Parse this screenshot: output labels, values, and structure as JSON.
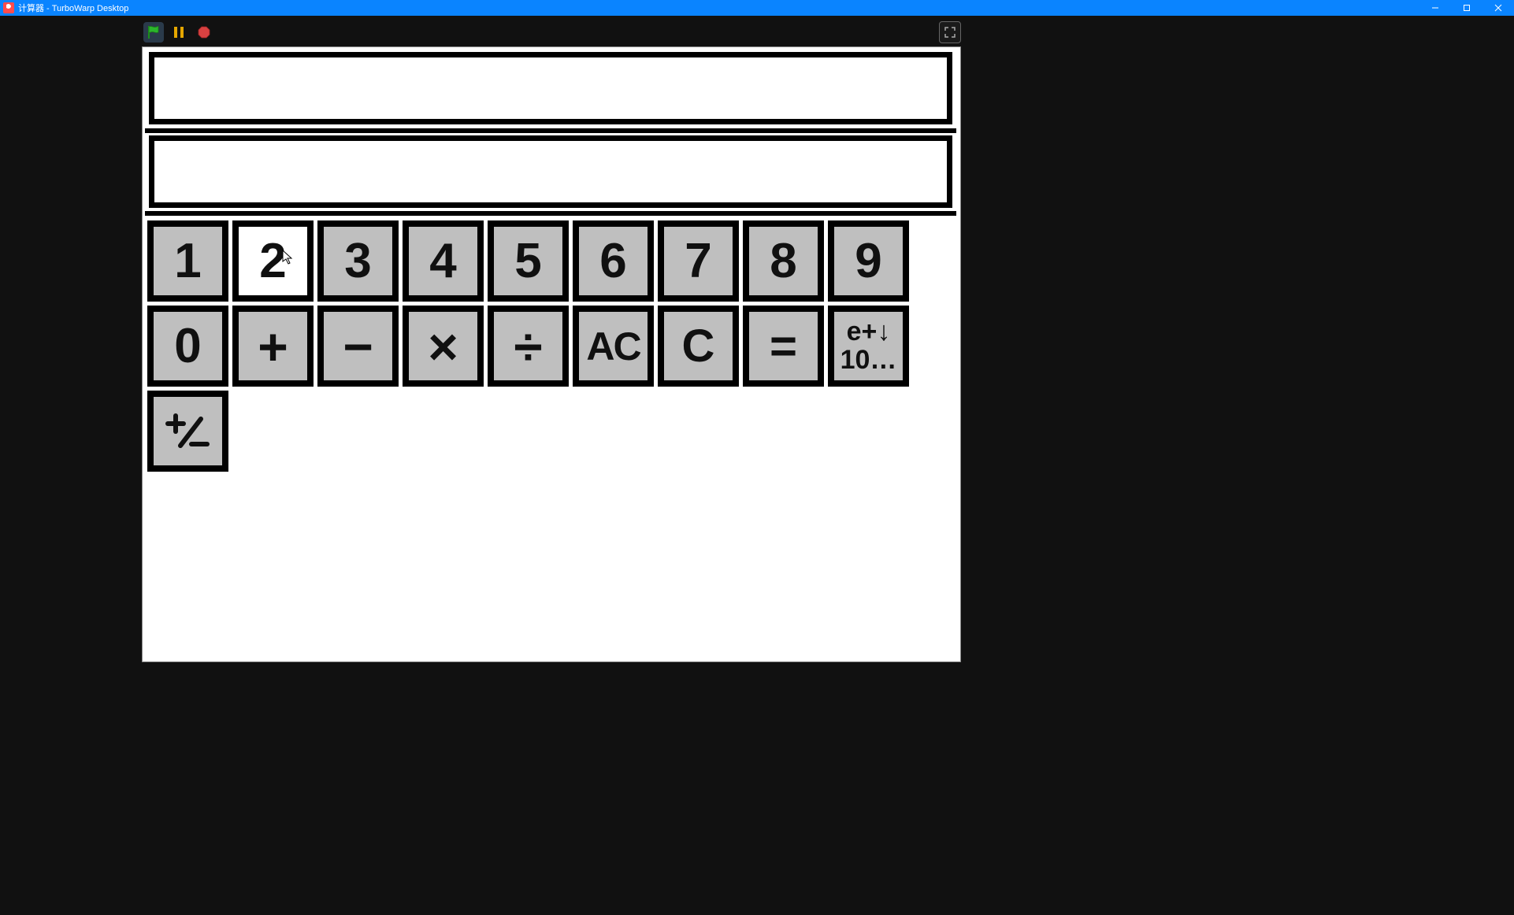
{
  "window": {
    "title": "计算器 - TurboWarp Desktop"
  },
  "controls": {
    "flag_tooltip": "Go",
    "pause_tooltip": "Pause",
    "stop_tooltip": "Stop",
    "fullscreen_tooltip": "Full Screen"
  },
  "display": {
    "line1": "",
    "line2": ""
  },
  "keys": {
    "row1": [
      "1",
      "2",
      "3",
      "4",
      "5",
      "6",
      "7",
      "8",
      "9"
    ],
    "row2": [
      "0",
      "+",
      "−",
      "×",
      "÷",
      "AC",
      "C",
      "="
    ],
    "sci_top": "e+↓",
    "sci_bot": "10…",
    "plusminus": "⁺⁄₋"
  },
  "state": {
    "hovered_key_index_row1": 1
  }
}
